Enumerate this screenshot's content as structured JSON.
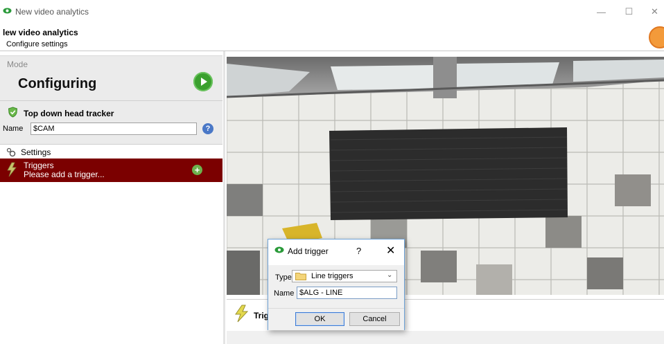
{
  "window": {
    "title": "New video analytics",
    "controls": {
      "minimize": "—",
      "maximize": "☐",
      "close": "✕"
    }
  },
  "header": {
    "title": "lew video analytics",
    "subtitle": "Configure settings"
  },
  "left_panel": {
    "mode": {
      "label": "Mode",
      "value": "Configuring"
    },
    "tracker": {
      "title": "Top down head tracker",
      "name_label": "Name",
      "name_value": "$CAM",
      "help": "?"
    },
    "settings": {
      "label": "Settings"
    },
    "triggers": {
      "label": "Triggers",
      "hint": "Please add a trigger...",
      "add": "+"
    }
  },
  "bottom_strip": {
    "label": "Trig"
  },
  "dialog": {
    "title": "Add trigger",
    "help": "?",
    "close": "✕",
    "type_label": "Type",
    "type_value": "Line triggers",
    "name_label": "Name",
    "name_value": "$ALG - LINE",
    "ok_label": "OK",
    "cancel_label": "Cancel"
  },
  "colors": {
    "triggers_row": "#7b0000",
    "play_button": "#3aa02e",
    "dialog_border": "#6ea3d8",
    "help_icon": "#4a78c7"
  },
  "icons": [
    "eye-icon",
    "play-icon",
    "shield-icon",
    "help-icon",
    "settings-icon",
    "lightning-icon",
    "add-icon",
    "folder-icon",
    "chevron-down-icon"
  ]
}
